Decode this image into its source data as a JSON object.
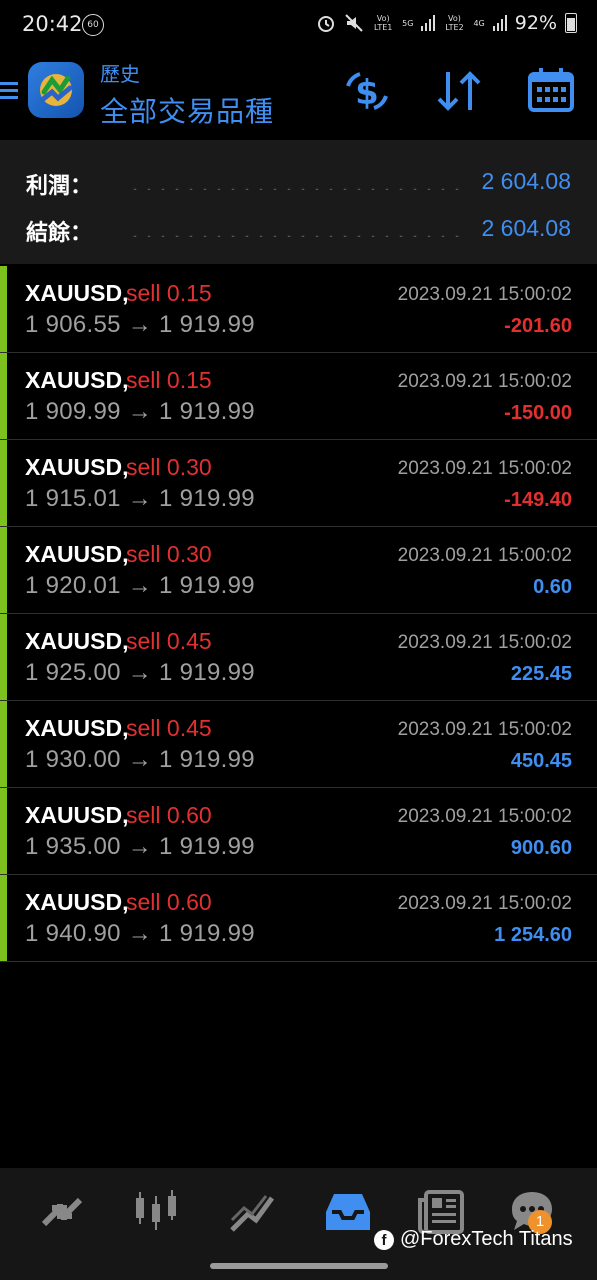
{
  "status": {
    "time": "20:42",
    "badge60": "60",
    "battery": "92%",
    "volte1": "Vo) LTE1",
    "volte2": "Vo) LTE2",
    "net1": "5G",
    "net2": "4G"
  },
  "header": {
    "subtitle": "歷史",
    "title": "全部交易品種"
  },
  "summary": {
    "profit_label": "利潤：",
    "profit_value": "2 604.08",
    "balance_label": "結餘：",
    "balance_value": "2 604.08"
  },
  "deals": [
    {
      "symbol": "XAUUSD,",
      "side": "sell 0.15",
      "prices": "1 906.55 → 1 919.99",
      "time": "2023.09.21 15:00:02",
      "profit": "-201.60"
    },
    {
      "symbol": "XAUUSD,",
      "side": "sell 0.15",
      "prices": "1 909.99 → 1 919.99",
      "time": "2023.09.21 15:00:02",
      "profit": "-150.00"
    },
    {
      "symbol": "XAUUSD,",
      "side": "sell 0.30",
      "prices": "1 915.01 → 1 919.99",
      "time": "2023.09.21 15:00:02",
      "profit": "-149.40"
    },
    {
      "symbol": "XAUUSD,",
      "side": "sell 0.30",
      "prices": "1 920.01 → 1 919.99",
      "time": "2023.09.21 15:00:02",
      "profit": "0.60"
    },
    {
      "symbol": "XAUUSD,",
      "side": "sell 0.45",
      "prices": "1 925.00 → 1 919.99",
      "time": "2023.09.21 15:00:02",
      "profit": "225.45"
    },
    {
      "symbol": "XAUUSD,",
      "side": "sell 0.45",
      "prices": "1 930.00 → 1 919.99",
      "time": "2023.09.21 15:00:02",
      "profit": "450.45"
    },
    {
      "symbol": "XAUUSD,",
      "side": "sell 0.60",
      "prices": "1 935.00 → 1 919.99",
      "time": "2023.09.21 15:00:02",
      "profit": "900.60"
    },
    {
      "symbol": "XAUUSD,",
      "side": "sell 0.60",
      "prices": "1 940.90 → 1 919.99",
      "time": "2023.09.21 15:00:02",
      "profit": "1 254.60"
    }
  ],
  "nav": {
    "chat_badge": "1"
  },
  "watermark": {
    "text": "@ForexTech Titans"
  },
  "colors": {
    "accent": "#3f8ef0",
    "loss": "#e23030",
    "gain": "#3f8ef0",
    "bar": "#7cc11e"
  }
}
